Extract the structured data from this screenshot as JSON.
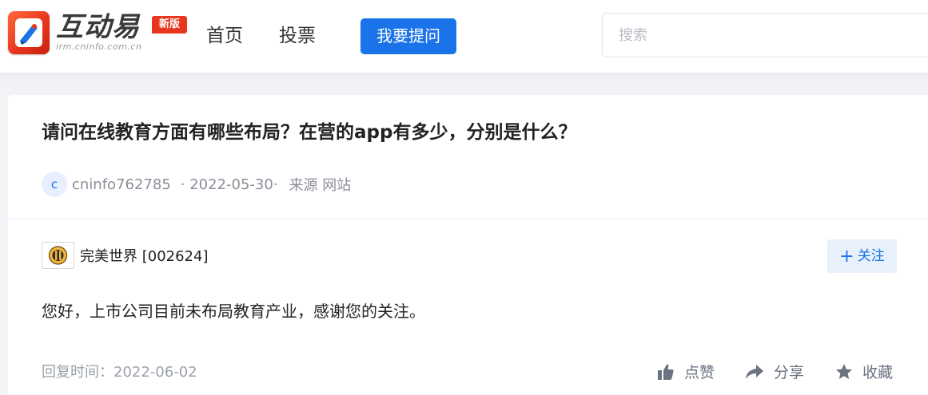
{
  "header": {
    "logo_text": "互动易",
    "logo_subtext": "irm.cninfo.com.cn",
    "new_badge": "新版",
    "nav": {
      "home": "首页",
      "vote": "投票"
    },
    "ask_button": "我要提问",
    "search_placeholder": "搜索"
  },
  "question": {
    "title": "请问在线教育方面有哪些布局？在营的app有多少，分别是什么？",
    "avatar_letter": "c",
    "user": "cninfo762785",
    "date": "· 2022-05-30·",
    "source": "来源 网站"
  },
  "answer": {
    "company": "完美世界 [002624]",
    "follow_button": "关注",
    "text": "您好，上市公司目前未布局教育产业，感谢您的关注。",
    "reply_time": "回复时间：2022-06-02",
    "actions": {
      "like": "点赞",
      "share": "分享",
      "favorite": "收藏"
    }
  },
  "colors": {
    "accent": "#1a73e8",
    "brand_red": "#e8361e",
    "muted_text": "#8a8f99"
  }
}
